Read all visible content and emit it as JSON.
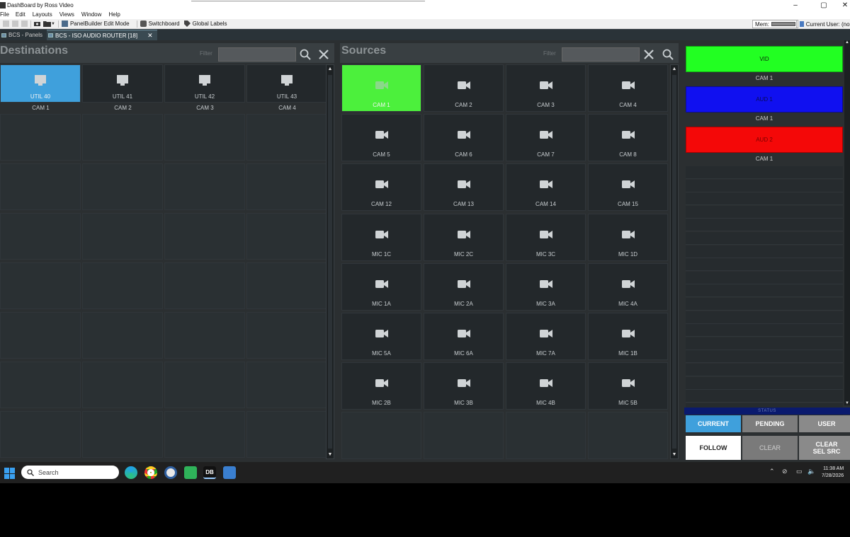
{
  "window": {
    "title": "DashBoard by Ross Video"
  },
  "menu": [
    "File",
    "Edit",
    "Layouts",
    "Views",
    "Window",
    "Help"
  ],
  "toolbar": {
    "panelbuilder": "PanelBuilder Edit Mode",
    "switchboard": "Switchboard",
    "global_labels": "Global Labels",
    "mem_label": "Mem:",
    "current_user": "Current User: (non"
  },
  "tabs": [
    {
      "label": "BCS - Panels",
      "active": false
    },
    {
      "label": "BCS - ISO AUDIO ROUTER [18]",
      "active": true
    }
  ],
  "destinations": {
    "title": "Destinations",
    "filter_label": "Filter",
    "filter_value": "",
    "cells": [
      {
        "label": "UTIL 40",
        "source": "CAM 1",
        "selected": true
      },
      {
        "label": "UTIL 41",
        "source": "CAM 2",
        "selected": false
      },
      {
        "label": "UTIL 42",
        "source": "CAM 3",
        "selected": false
      },
      {
        "label": "UTIL 43",
        "source": "CAM 4",
        "selected": false
      }
    ]
  },
  "sources": {
    "title": "Sources",
    "filter_label": "Filter",
    "filter_value": "",
    "cells": [
      "CAM 1",
      "CAM 2",
      "CAM 3",
      "CAM 4",
      "CAM 5",
      "CAM 6",
      "CAM 7",
      "CAM 8",
      "CAM 12",
      "CAM 13",
      "CAM 14",
      "CAM 15",
      "MIC 1C",
      "MIC 2C",
      "MIC 3C",
      "MIC 1D",
      "MIC 1A",
      "MIC 2A",
      "MIC 3A",
      "MIC 4A",
      "MIC 5A",
      "MIC 6A",
      "MIC 7A",
      "MIC 1B",
      "MIC 2B",
      "MIC 3B",
      "MIC 4B",
      "MIC 5B"
    ],
    "selected_index": 0
  },
  "levels": [
    {
      "name": "VID",
      "source": "CAM 1",
      "color": "#22ff22"
    },
    {
      "name": "AUD 1",
      "source": "CAM 1",
      "color": "#1010f0"
    },
    {
      "name": "AUD 2",
      "source": "CAM 1",
      "color": "#f40808"
    }
  ],
  "status": {
    "label": "STATUS",
    "current": "CURRENT",
    "pending": "PENDING",
    "user": "USER",
    "follow": "FOLLOW",
    "clear": "CLEAR",
    "clear_sel_src": "CLEAR\nSEL SRC"
  },
  "taskbar": {
    "search_placeholder": "Search",
    "time": "11:38 AM",
    "date": "7/28/2026"
  },
  "colors": {
    "selected_dest": "#3fa0dc",
    "selected_source": "#4cf03c",
    "panel_bg": "#2b2f31"
  }
}
